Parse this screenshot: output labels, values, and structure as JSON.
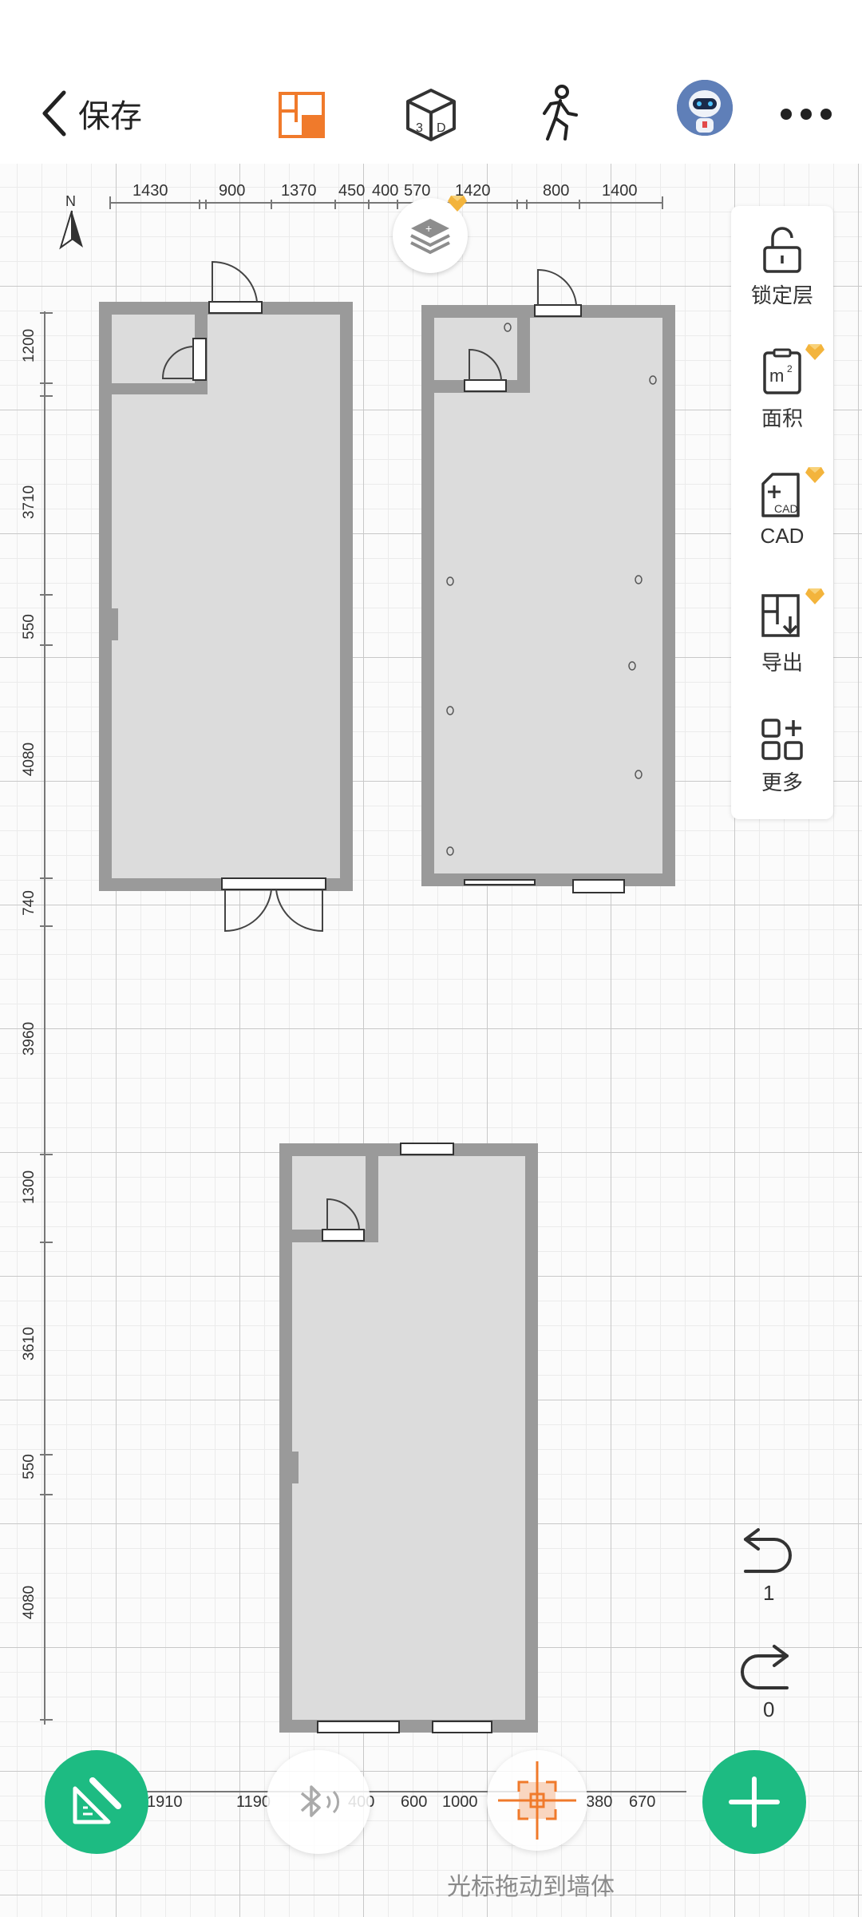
{
  "header": {
    "back_label": "保存",
    "icons": [
      "back-chevron-icon",
      "floorplan-2d-icon",
      "cube-3d-icon",
      "walk-person-icon",
      "robot-avatar",
      "more-dots-icon"
    ],
    "accent_color": "#f07a2b"
  },
  "compass": {
    "label": "N"
  },
  "top_ruler": [
    "1430",
    "900",
    "1370",
    "450",
    "400",
    "570",
    "1420",
    "800",
    "1400"
  ],
  "left_ruler": [
    "1200",
    "3710",
    "550",
    "4080",
    "740",
    "3960",
    "1300",
    "3610",
    "550",
    "4080"
  ],
  "side_menu": {
    "items": [
      {
        "label": "锁定层",
        "icon": "unlock-icon",
        "premium": false
      },
      {
        "label": "面积",
        "icon": "area-m2-icon",
        "premium": true
      },
      {
        "label": "CAD",
        "icon": "cad-file-icon",
        "premium": true
      },
      {
        "label": "导出",
        "icon": "export-icon",
        "premium": true
      },
      {
        "label": "更多",
        "icon": "more-grid-icon",
        "premium": false
      }
    ]
  },
  "undo": {
    "count": "1"
  },
  "redo": {
    "count": "0"
  },
  "bottom_ruler": [
    "1910",
    "1190",
    "400",
    "600",
    "1000",
    "380",
    "670"
  ],
  "bottom_hint": "光标拖动到墙体",
  "colors": {
    "fab_green": "#1dbb82",
    "wall_gray": "#9a9a9a",
    "floor_gray": "#dcdcdc",
    "premium_gold": "#f3b43c"
  }
}
